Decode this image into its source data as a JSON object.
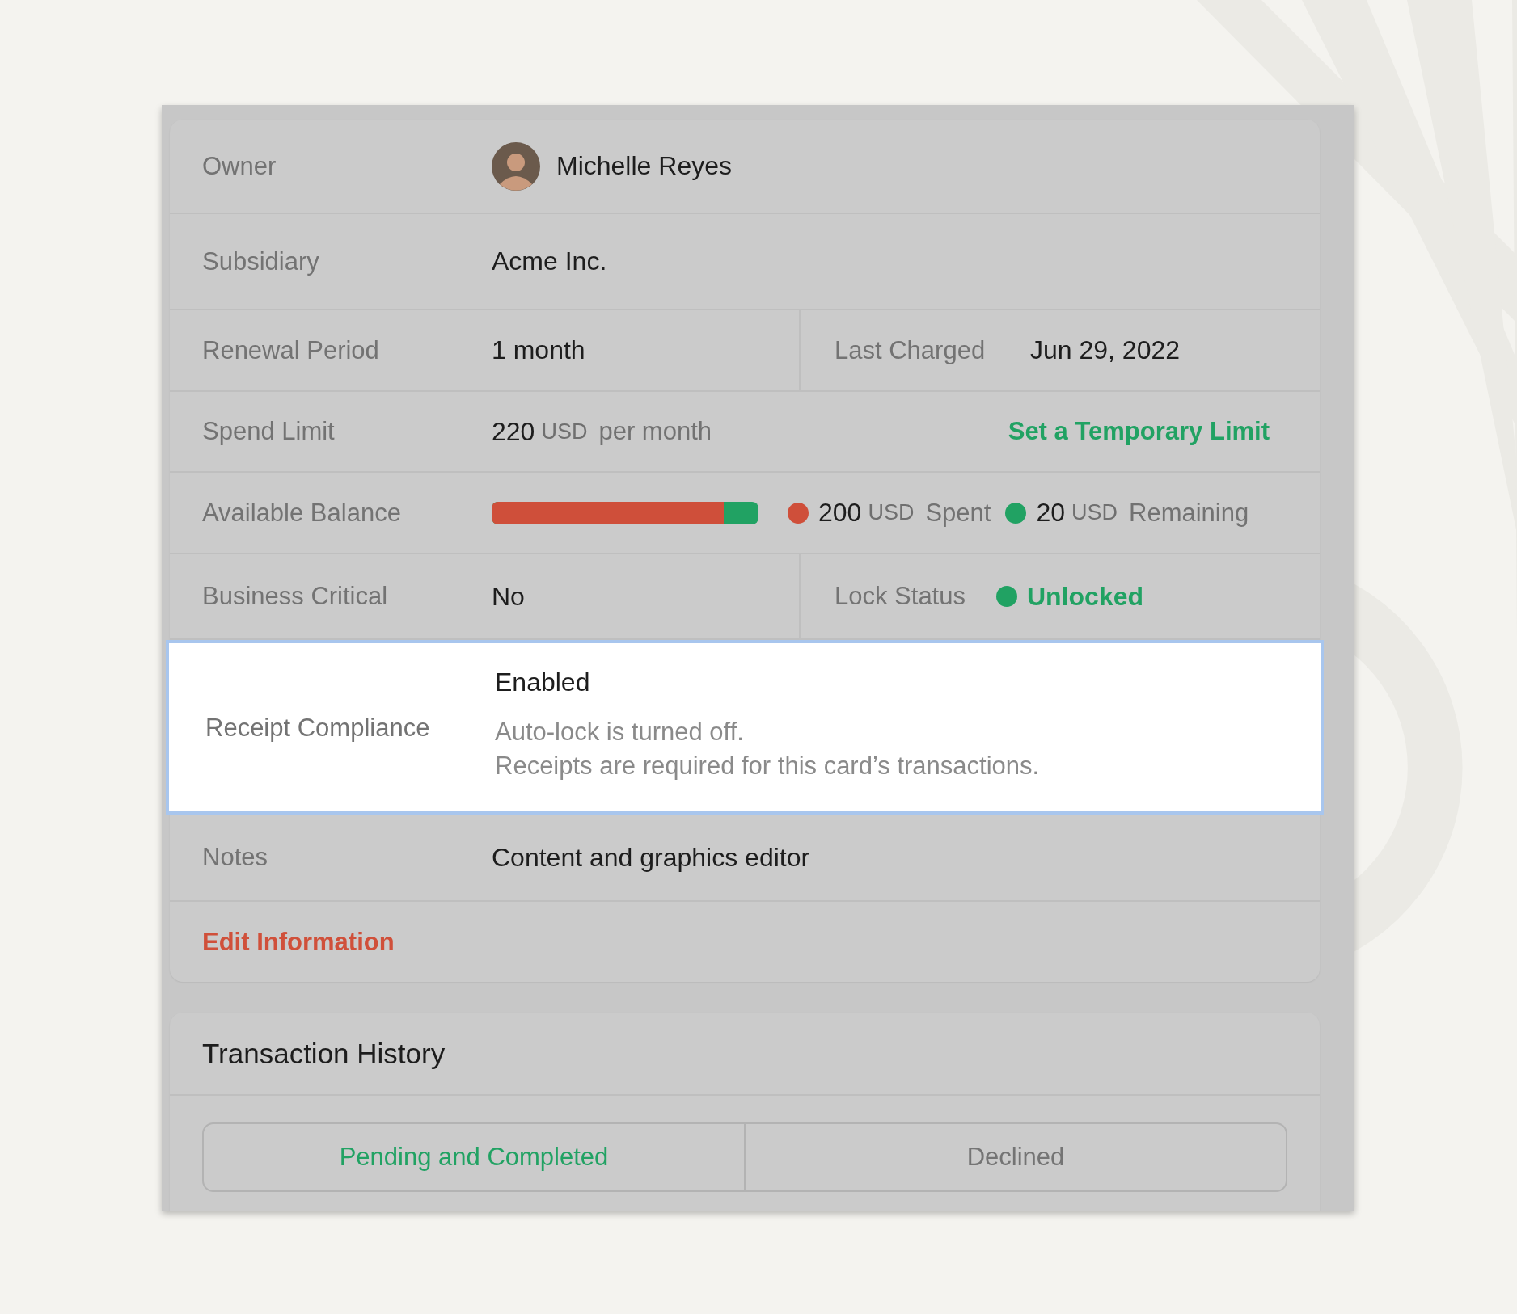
{
  "owner": {
    "label": "Owner",
    "name": "Michelle Reyes"
  },
  "subsidiary": {
    "label": "Subsidiary",
    "value": "Acme Inc."
  },
  "renewal": {
    "label": "Renewal Period",
    "value": "1 month",
    "last_charged_label": "Last Charged",
    "last_charged": "Jun 29, 2022"
  },
  "spend_limit": {
    "label": "Spend Limit",
    "amount": "220",
    "currency": "USD",
    "period": "per month",
    "action": "Set a Temporary Limit"
  },
  "balance": {
    "label": "Available Balance",
    "level": 0.87,
    "legend": [
      {
        "amount": "200",
        "currency": "USD",
        "caption": "Spent",
        "color": "#cf4f3a"
      },
      {
        "amount": "20",
        "currency": "USD",
        "caption": "Remaining",
        "color": "#21a263"
      }
    ]
  },
  "business_critical": {
    "label": "Business Critical",
    "value": "No",
    "lock_label": "Lock Status",
    "lock_status": "Unlocked",
    "locked": false
  },
  "receipt_compliance": {
    "label": "Receipt Compliance",
    "value": "Enabled",
    "highlighted": true,
    "notes": [
      "Auto-lock is turned off.",
      "Receipts are required for this card’s transactions."
    ]
  },
  "notes": {
    "label": "Notes",
    "value": "Content and graphics editor"
  },
  "edit_action": "Edit Information",
  "transactions": {
    "title": "Transaction History",
    "tabs": [
      {
        "label": "Pending and Completed",
        "selected": true
      },
      {
        "label": "Declined",
        "selected": false
      }
    ]
  }
}
